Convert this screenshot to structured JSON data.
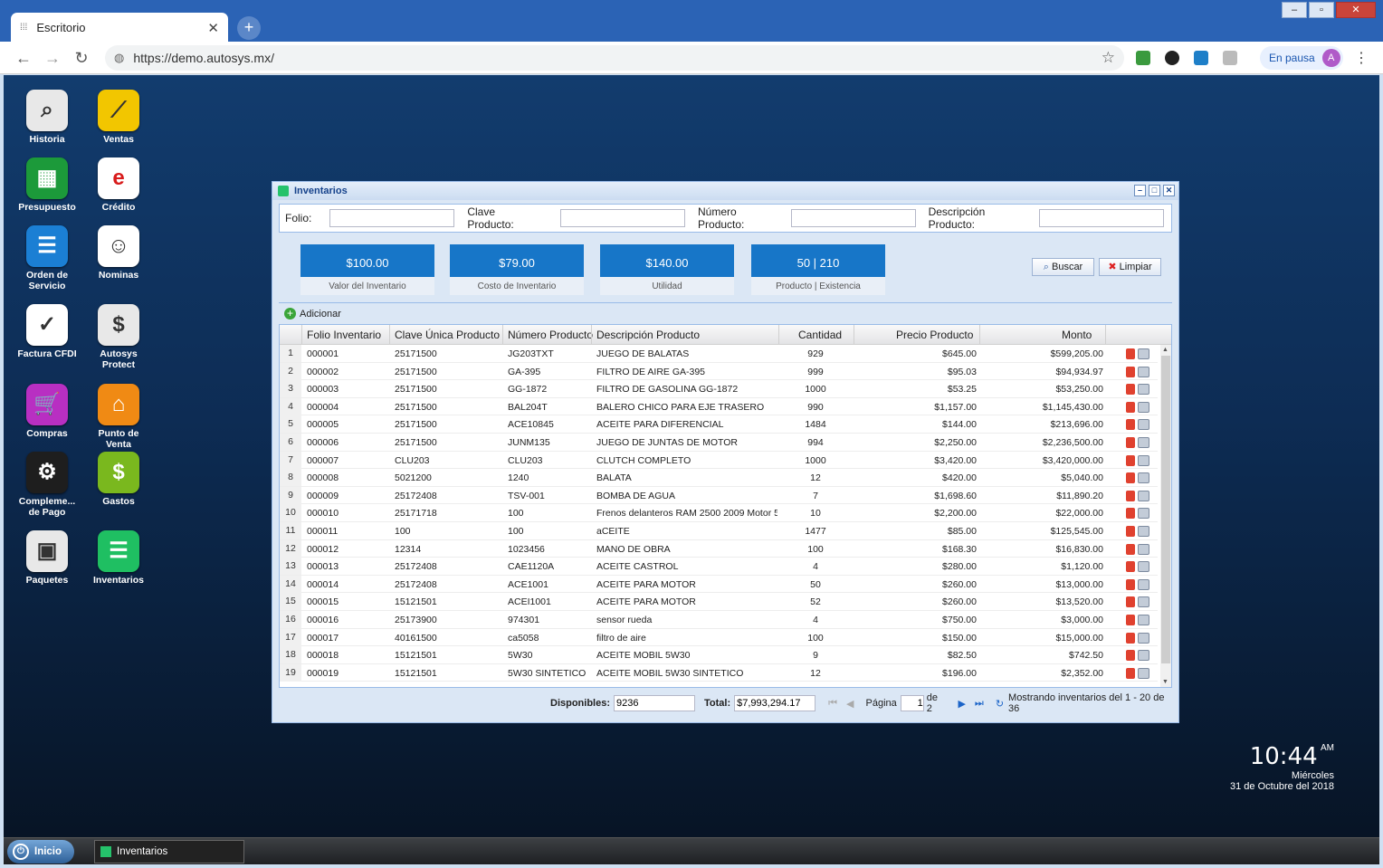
{
  "browser": {
    "tab_title": "Escritorio",
    "url": "https://demo.autosys.mx/",
    "profile_status": "En pausa",
    "profile_initial": "A"
  },
  "desktop": {
    "icons": [
      {
        "label": "Historia",
        "icon": "magnifier-icon",
        "color": "#e8e8e8"
      },
      {
        "label": "Ventas",
        "icon": "trend-chart-icon",
        "color": "#f2c600"
      },
      {
        "label": "Presupuesto",
        "icon": "spreadsheet-icon",
        "color": "#1c9a3a"
      },
      {
        "label": "Crédito",
        "icon": "credit-logo-icon",
        "color": "#ffffff"
      },
      {
        "label": "Orden de Servicio",
        "icon": "document-icon",
        "color": "#1b7fd4"
      },
      {
        "label": "Nominas",
        "icon": "payroll-icon",
        "color": "#ffffff"
      },
      {
        "label": "Factura CFDI",
        "icon": "xml-sat-icon",
        "color": "#ffffff"
      },
      {
        "label": "Autosys Protect",
        "icon": "thief-icon",
        "color": "#e8e8e8"
      },
      {
        "label": "Compras",
        "icon": "cart-icon",
        "color": "#b82fc2"
      },
      {
        "label": "Punto de Venta",
        "icon": "store-icon",
        "color": "#f08a14"
      },
      {
        "label": "Compleme... de Pago",
        "icon": "steam-icon",
        "color": "#1e1e1e"
      },
      {
        "label": "Gastos",
        "icon": "coins-icon",
        "color": "#7ab81e"
      },
      {
        "label": "Paquetes",
        "icon": "package-icon",
        "color": "#e8e8e8"
      },
      {
        "label": "Inventarios",
        "icon": "list-icon",
        "color": "#1fbf62"
      }
    ],
    "clock": {
      "time": "10:44",
      "ampm": "AM",
      "weekday": "Miércoles",
      "date": "31 de Octubre del 2018"
    }
  },
  "taskbar": {
    "start_label": "Inicio",
    "item_label": "Inventarios"
  },
  "window": {
    "title": "Inventarios",
    "filters": {
      "folio_label": "Folio:",
      "clave_label": "Clave Producto:",
      "numero_label": "Número Producto:",
      "descripcion_label": "Descripción Producto:",
      "folio_value": "",
      "clave_value": "",
      "numero_value": "",
      "descripcion_value": ""
    },
    "stats": [
      {
        "value": "$100.00",
        "label": "Valor del Inventario"
      },
      {
        "value": "$79.00",
        "label": "Costo de Inventario"
      },
      {
        "value": "$140.00",
        "label": "Utilidad"
      },
      {
        "value": "50 | 210",
        "label": "Producto | Existencia"
      }
    ],
    "buscar_label": "Buscar",
    "limpiar_label": "Limpiar",
    "add_label": "Adicionar",
    "columns": [
      "Folio Inventario",
      "Clave Única Producto",
      "Número Producto",
      "Descripción Producto",
      "Cantidad",
      "Precio Producto",
      "Monto"
    ],
    "rows": [
      {
        "n": "1",
        "folio": "000001",
        "clave": "25171500",
        "numero": "JG203TXT",
        "desc": "JUEGO DE BALATAS",
        "cant": "929",
        "precio": "$645.00",
        "monto": "$599,205.00"
      },
      {
        "n": "2",
        "folio": "000002",
        "clave": "25171500",
        "numero": "GA-395",
        "desc": "FILTRO DE AIRE GA-395",
        "cant": "999",
        "precio": "$95.03",
        "monto": "$94,934.97"
      },
      {
        "n": "3",
        "folio": "000003",
        "clave": "25171500",
        "numero": "GG-1872",
        "desc": "FILTRO DE GASOLINA GG-1872",
        "cant": "1000",
        "precio": "$53.25",
        "monto": "$53,250.00"
      },
      {
        "n": "4",
        "folio": "000004",
        "clave": "25171500",
        "numero": "BAL204T",
        "desc": "BALERO CHICO PARA EJE TRASERO",
        "cant": "990",
        "precio": "$1,157.00",
        "monto": "$1,145,430.00"
      },
      {
        "n": "5",
        "folio": "000005",
        "clave": "25171500",
        "numero": "ACE10845",
        "desc": "ACEITE PARA DIFERENCIAL",
        "cant": "1484",
        "precio": "$144.00",
        "monto": "$213,696.00"
      },
      {
        "n": "6",
        "folio": "000006",
        "clave": "25171500",
        "numero": "JUNM135",
        "desc": "JUEGO DE JUNTAS DE MOTOR",
        "cant": "994",
        "precio": "$2,250.00",
        "monto": "$2,236,500.00"
      },
      {
        "n": "7",
        "folio": "000007",
        "clave": "CLU203",
        "numero": "CLU203",
        "desc": "CLUTCH COMPLETO",
        "cant": "1000",
        "precio": "$3,420.00",
        "monto": "$3,420,000.00"
      },
      {
        "n": "8",
        "folio": "000008",
        "clave": "5021200",
        "numero": "1240",
        "desc": "BALATA",
        "cant": "12",
        "precio": "$420.00",
        "monto": "$5,040.00"
      },
      {
        "n": "9",
        "folio": "000009",
        "clave": "25172408",
        "numero": "TSV-001",
        "desc": "BOMBA DE AGUA",
        "cant": "7",
        "precio": "$1,698.60",
        "monto": "$11,890.20"
      },
      {
        "n": "10",
        "folio": "000010",
        "clave": "25171718",
        "numero": "100",
        "desc": "Frenos delanteros RAM 2500 2009 Motor 5...",
        "cant": "10",
        "precio": "$2,200.00",
        "monto": "$22,000.00"
      },
      {
        "n": "11",
        "folio": "000011",
        "clave": "100",
        "numero": "100",
        "desc": "aCEITE",
        "cant": "1477",
        "precio": "$85.00",
        "monto": "$125,545.00"
      },
      {
        "n": "12",
        "folio": "000012",
        "clave": "12314",
        "numero": "1023456",
        "desc": "MANO DE OBRA",
        "cant": "100",
        "precio": "$168.30",
        "monto": "$16,830.00"
      },
      {
        "n": "13",
        "folio": "000013",
        "clave": "25172408",
        "numero": "CAE1120A",
        "desc": "ACEITE CASTROL",
        "cant": "4",
        "precio": "$280.00",
        "monto": "$1,120.00"
      },
      {
        "n": "14",
        "folio": "000014",
        "clave": "25172408",
        "numero": "ACE1001",
        "desc": "ACEITE PARA MOTOR",
        "cant": "50",
        "precio": "$260.00",
        "monto": "$13,000.00"
      },
      {
        "n": "15",
        "folio": "000015",
        "clave": "15121501",
        "numero": "ACEI1001",
        "desc": "ACEITE PARA MOTOR",
        "cant": "52",
        "precio": "$260.00",
        "monto": "$13,520.00"
      },
      {
        "n": "16",
        "folio": "000016",
        "clave": "25173900",
        "numero": "974301",
        "desc": "sensor rueda",
        "cant": "4",
        "precio": "$750.00",
        "monto": "$3,000.00"
      },
      {
        "n": "17",
        "folio": "000017",
        "clave": "40161500",
        "numero": "ca5058",
        "desc": "filtro de aire",
        "cant": "100",
        "precio": "$150.00",
        "monto": "$15,000.00"
      },
      {
        "n": "18",
        "folio": "000018",
        "clave": "15121501",
        "numero": "5W30",
        "desc": "ACEITE MOBIL 5W30",
        "cant": "9",
        "precio": "$82.50",
        "monto": "$742.50"
      },
      {
        "n": "19",
        "folio": "000019",
        "clave": "15121501",
        "numero": "5W30 SINTETICO",
        "desc": "ACEITE MOBIL 5W30 SINTETICO",
        "cant": "12",
        "precio": "$196.00",
        "monto": "$2,352.00"
      }
    ],
    "footer": {
      "disponibles_label": "Disponibles:",
      "disponibles_value": "9236",
      "total_label": "Total:",
      "total_value": "$7,993,294.17",
      "pagina_label": "Página",
      "page_value": "1",
      "of_pages": "de 2",
      "showing": "Mostrando inventarios del 1 - 20 de 36"
    }
  }
}
